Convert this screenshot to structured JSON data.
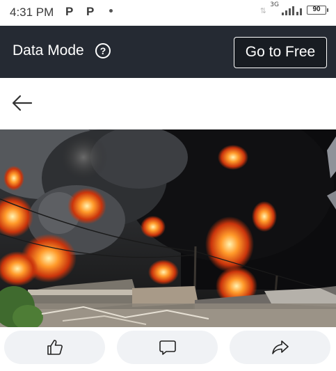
{
  "status_bar": {
    "time": "4:31 PM",
    "notif_1": "P",
    "notif_2": "P",
    "network_type": "3G",
    "battery": "90",
    "icons": [
      "p-notification-icon",
      "p-notification-icon",
      "dot-icon",
      "data-arrows-icon",
      "signal-bars-icon",
      "battery-icon"
    ]
  },
  "data_mode_bar": {
    "title": "Data Mode",
    "help_icon": "?",
    "go_free_label": "Go to Free",
    "background": "#252a33"
  },
  "nav": {
    "back_icon": "arrow-left-icon"
  },
  "photo": {
    "subject": "fire-photo"
  },
  "actions": {
    "like_icon": "thumbs-up-icon",
    "comment_icon": "speech-bubble-icon",
    "share_icon": "share-arrow-icon",
    "button_bg": "#f0f2f5"
  }
}
